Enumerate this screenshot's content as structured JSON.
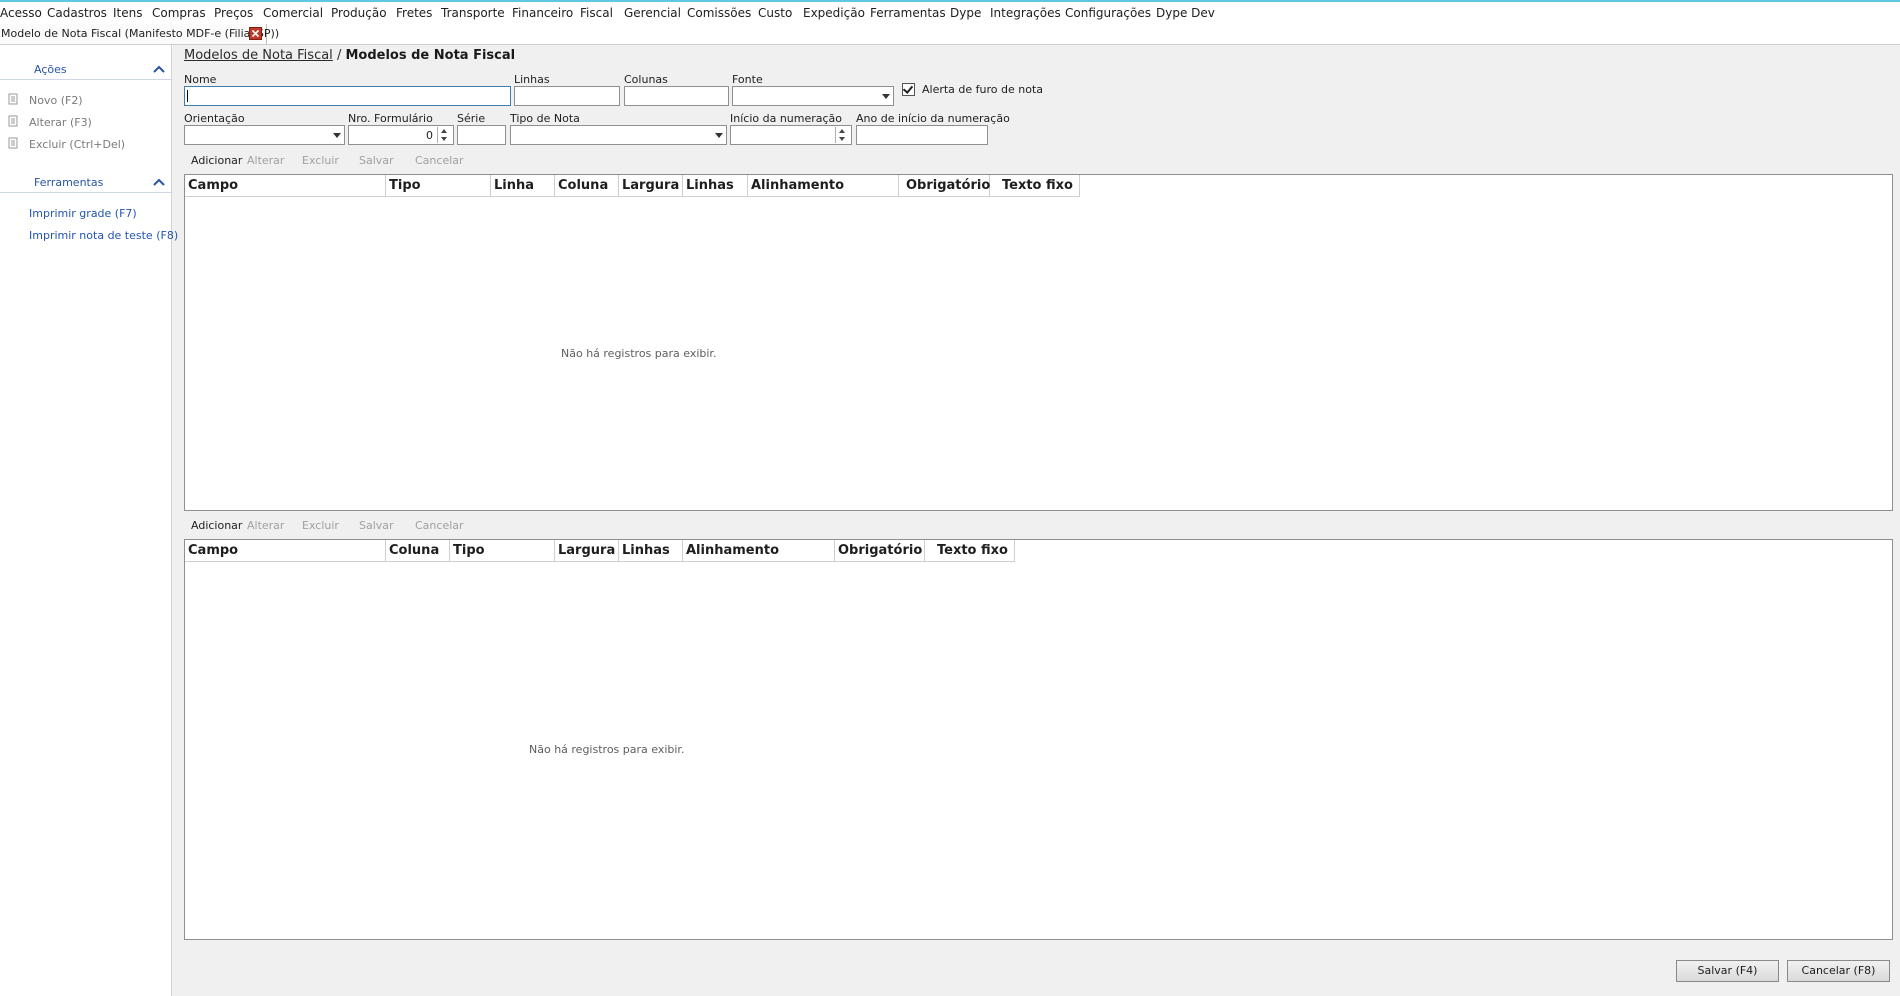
{
  "menu": [
    "Acesso",
    "Cadastros",
    "Itens",
    "Compras",
    "Preços",
    "Comercial",
    "Produção",
    "Fretes",
    "Transporte",
    "Financeiro",
    "Fiscal",
    "Gerencial",
    "Comissões",
    "Custo",
    "Expedição",
    "Ferramentas",
    "Dype",
    "Integrações",
    "Configurações",
    "Dype Dev"
  ],
  "tab": {
    "label": "Modelo de Nota Fiscal (Manifesto MDF-e (Filial SP))"
  },
  "sidebar": {
    "acoes_header": "Ações",
    "acoes": [
      "Novo (F2)",
      "Alterar (F3)",
      "Excluir (Ctrl+Del)"
    ],
    "ferramentas_header": "Ferramentas",
    "ferramentas": [
      "Imprimir grade (F7)",
      "Imprimir nota de teste (F8)"
    ]
  },
  "breadcrumb": {
    "link": "Modelos de Nota Fiscal",
    "separator": "/",
    "current": "Modelos de Nota Fiscal"
  },
  "form": {
    "nome_label": "Nome",
    "nome_value": "",
    "linhas_label": "Linhas",
    "linhas_value": "",
    "colunas_label": "Colunas",
    "colunas_value": "",
    "fonte_label": "Fonte",
    "fonte_value": "",
    "alerta_label": "Alerta de furo de nota",
    "alerta_checked": true,
    "orientacao_label": "Orientação",
    "orientacao_value": "",
    "nro_formulario_label": "Nro. Formulário",
    "nro_formulario_value": "0",
    "serie_label": "Série",
    "serie_value": "",
    "tipo_nota_label": "Tipo de Nota",
    "tipo_nota_value": "",
    "inicio_numeracao_label": "Início da numeração",
    "inicio_numeracao_value": "",
    "ano_inicio_label": "Ano de início da numeração",
    "ano_inicio_value": ""
  },
  "toolbar": {
    "add": "Adicionar",
    "edit": "Alterar",
    "delete": "Excluir",
    "save": "Salvar",
    "cancel": "Cancelar"
  },
  "grid1": {
    "columns": [
      "Campo",
      "Tipo",
      "Linha",
      "Coluna",
      "Largura",
      "Linhas",
      "Alinhamento",
      "Obrigatório",
      "Texto fixo"
    ],
    "empty": "Não há registros para exibir."
  },
  "grid2": {
    "columns": [
      "Campo",
      "Coluna",
      "Tipo",
      "Largura",
      "Linhas",
      "Alinhamento",
      "Obrigatório",
      "Texto fixo"
    ],
    "empty": "Não há registros para exibir."
  },
  "footer": {
    "save": "Salvar (F4)",
    "cancel": "Cancelar (F8)"
  },
  "colors": {
    "link": "#2354b4",
    "accent_line": "#5ec8e0",
    "close": "#c0392b"
  }
}
